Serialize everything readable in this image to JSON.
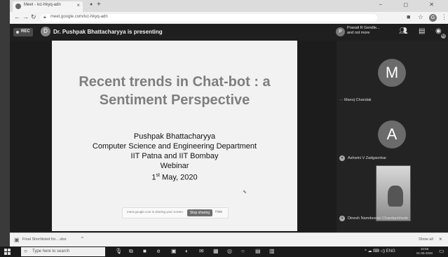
{
  "browser": {
    "tab_title": "Meet - ivz-hkyq-adn",
    "window_controls": "− ◻ ✕",
    "url": "meet.google.com/ivz-hkyq-adn",
    "profile_initial": "G"
  },
  "meet": {
    "rec_label": "REC",
    "presenter_initial": "D",
    "presenting_text": "Dr. Pushpak Bhattacharyya is presenting",
    "attendee_initial": "P",
    "attendee_line1": "Pranali R Gendle...",
    "attendee_line2": "and not more",
    "participants_count": "42"
  },
  "slide": {
    "title_line1": "Recent trends in Chat-bot : a",
    "title_line2": "Sentiment Perspective",
    "author": "Pushpak Bhattacharyya",
    "department": "Computer Science and Engineering Department",
    "institutes": "IIT Patna and IIT Bombay",
    "event": "Webinar",
    "date_num": "1",
    "date_sup": "st",
    "date_rest": " May, 2020"
  },
  "sharing_bar": {
    "text": "meet.google.com is sharing your screen.",
    "stop_label": "Stop sharing",
    "hide_label": "Hide"
  },
  "participants": [
    {
      "initial": "M",
      "name": "Manoj Chandak"
    },
    {
      "initial": "A",
      "name": "Ashwini V Zadgaonkar"
    },
    {
      "initial": "",
      "name": "Dinesh Namdeorao Chandankhede"
    }
  ],
  "downloads": {
    "file_name": "Final Shortlisted for....xlsx",
    "show_all": "Show all"
  },
  "taskbar": {
    "search_placeholder": "Type here to search",
    "tray_text": "^ ☁ ⌨ ◁) ENG",
    "time": "10:56",
    "date": "01-05-2020"
  },
  "icons": {
    "nav_back": "back-arrow-icon",
    "nav_forward": "forward-arrow-icon",
    "reload": "reload-icon",
    "lock": "lock-icon",
    "star": "bookmark-star-icon",
    "people": "people-icon",
    "chat": "chat-icon"
  }
}
